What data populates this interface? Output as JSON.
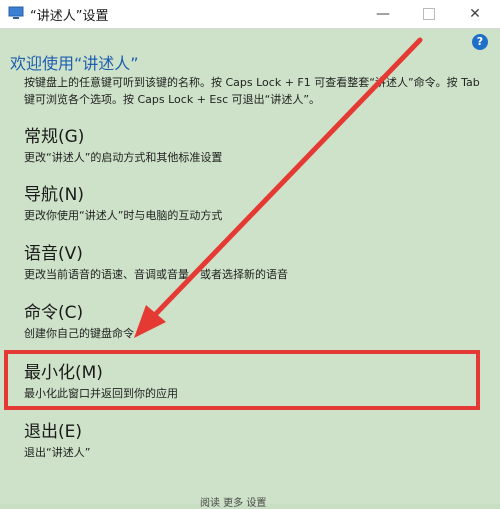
{
  "window": {
    "title": "“讲述人”设置",
    "minimize_glyph": "—",
    "close_glyph": "✕"
  },
  "help": {
    "glyph": "?"
  },
  "welcome": "欢迎使用“讲述人”",
  "intro": "按键盘上的任意键可听到该键的名称。按 Caps Lock + F1 可查看整套“讲述人”命令。按 Tab 键可浏览各个选项。按 Caps Lock + Esc 可退出“讲述人”。",
  "options": [
    {
      "title": "常规(G)",
      "desc": "更改“讲述人”的启动方式和其他标准设置"
    },
    {
      "title": "导航(N)",
      "desc": "更改你使用“讲述人”时与电脑的互动方式"
    },
    {
      "title": "语音(V)",
      "desc": "更改当前语音的语速、音调或音量，或者选择新的语音"
    },
    {
      "title": "命令(C)",
      "desc": "创建你自己的键盘命令"
    },
    {
      "title": "最小化(M)",
      "desc": "最小化此窗口并返回到你的应用"
    },
    {
      "title": "退出(E)",
      "desc": "退出“讲述人”"
    }
  ],
  "footer": "阅读 更多 设置",
  "colors": {
    "accent": "#1f5fb0",
    "highlight": "#e53a33",
    "background": "#cde2c8"
  }
}
